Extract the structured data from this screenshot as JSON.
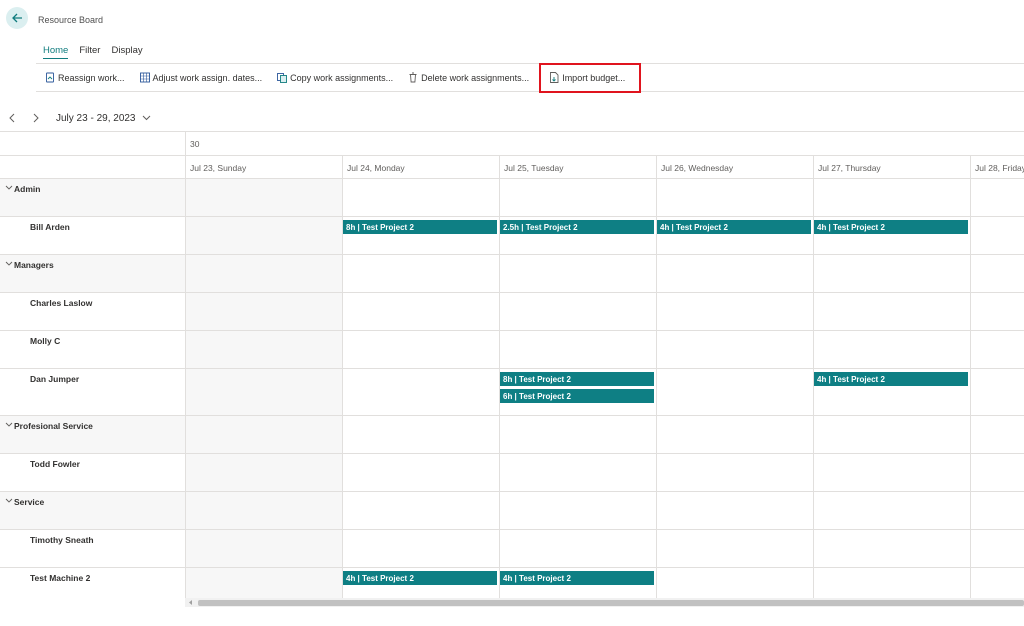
{
  "page": {
    "title": "Resource Board"
  },
  "tabs": [
    {
      "label": "Home",
      "active": true
    },
    {
      "label": "Filter",
      "active": false
    },
    {
      "label": "Display",
      "active": false
    }
  ],
  "actions": [
    {
      "label": "Reassign work...",
      "icon": "reassign-icon"
    },
    {
      "label": "Adjust work assign. dates...",
      "icon": "calendar-grid-icon"
    },
    {
      "label": "Copy work assignments...",
      "icon": "copy-icon"
    },
    {
      "label": "Delete work assignments...",
      "icon": "trash-icon"
    },
    {
      "label": "Import budget...",
      "icon": "import-document-icon",
      "highlighted": true
    }
  ],
  "date_nav": {
    "range": "July 23 - 29, 2023"
  },
  "week_number": "30",
  "days": [
    "Jul 23, Sunday",
    "Jul 24, Monday",
    "Jul 25, Tuesday",
    "Jul 26, Wednesday",
    "Jul 27, Thursday",
    "Jul 28, Friday"
  ],
  "rows": [
    {
      "type": "group",
      "name": "Admin"
    },
    {
      "type": "resource",
      "name": "Bill Arden",
      "assignments": [
        {
          "day": 1,
          "lane": 0,
          "label": "8h | Test Project 2"
        },
        {
          "day": 2,
          "lane": 0,
          "label": "2.5h | Test Project 2"
        },
        {
          "day": 3,
          "lane": 0,
          "label": "4h | Test Project 2"
        },
        {
          "day": 4,
          "lane": 0,
          "label": "4h | Test Project 2"
        }
      ]
    },
    {
      "type": "group",
      "name": "Managers"
    },
    {
      "type": "resource",
      "name": "Charles Laslow",
      "assignments": []
    },
    {
      "type": "resource",
      "name": "Molly C",
      "assignments": []
    },
    {
      "type": "resource",
      "name": "Dan  Jumper",
      "assignments": [
        {
          "day": 2,
          "lane": 0,
          "label": "8h | Test Project 2"
        },
        {
          "day": 2,
          "lane": 1,
          "label": "6h | Test Project 2"
        },
        {
          "day": 4,
          "lane": 0,
          "label": "4h | Test Project 2"
        }
      ]
    },
    {
      "type": "group",
      "name": "Profesional Service"
    },
    {
      "type": "resource",
      "name": "Todd Fowler",
      "assignments": []
    },
    {
      "type": "group",
      "name": "Service"
    },
    {
      "type": "resource",
      "name": "Timothy Sneath",
      "assignments": []
    },
    {
      "type": "resource",
      "name": "Test Machine 2",
      "assignments": [
        {
          "day": 1,
          "lane": 0,
          "label": "4h | Test Project 2"
        },
        {
          "day": 2,
          "lane": 0,
          "label": "4h | Test Project 2"
        }
      ]
    }
  ],
  "colors": {
    "accent": "#107c7e",
    "assignment_bar": "#0e7f84",
    "highlight_border": "#e0141e"
  }
}
